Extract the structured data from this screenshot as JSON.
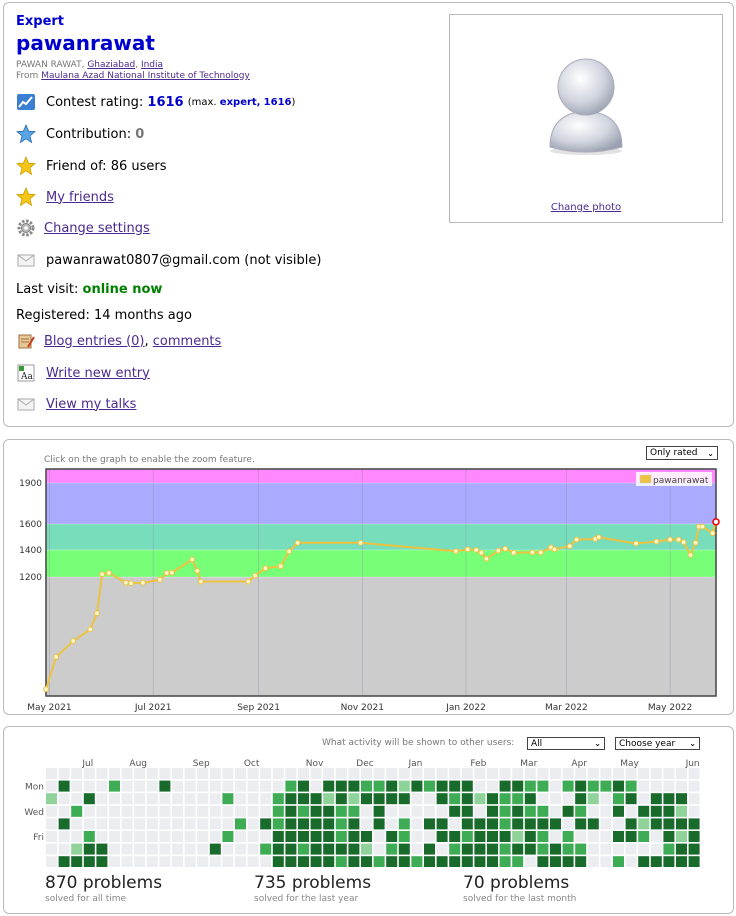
{
  "profile": {
    "rank": "Expert",
    "handle": "pawanrawat",
    "name": "PAWAN RAWAT,",
    "city": "Ghaziabad",
    "country": "India",
    "from_label": "From",
    "org": "Maulana Azad National Institute of Technology",
    "contest_rating_label": "Contest rating:",
    "rating": "1616",
    "max_open": "(max.",
    "max_rank": "expert,",
    "max_rating": "1616",
    "max_close": ")",
    "contribution_label": "Contribution:",
    "contribution": "0",
    "friend_of": "Friend of: 86 users",
    "my_friends": "My friends",
    "change_settings": "Change settings",
    "email": "pawanrawat0807@gmail.com (not visible)",
    "last_visit_label": "Last visit:",
    "last_visit": "online now",
    "registered": "Registered: 14 months ago",
    "blog_entries": "Blog entries (0)",
    "comma": ",",
    "comments": "comments",
    "write_new_entry": "Write new entry",
    "view_my_talks": "View my talks",
    "change_photo": "Change photo",
    "icons": [
      "rating-icon",
      "star-blue-icon",
      "star-icon",
      "star-icon",
      "gear-icon",
      "envelope-icon",
      "blog-icon",
      "write-icon",
      "talks-icon"
    ]
  },
  "rating_graph": {
    "hint": "Click on the graph to enable the zoom feature.",
    "filter_value": "Only rated"
  },
  "chart_data": {
    "type": "line",
    "series": [
      {
        "name": "pawanrawat",
        "color": "#edc240",
        "points": [
          [
            "2021-04-29",
            210
          ],
          [
            "2021-05-05",
            495
          ],
          [
            "2021-05-15",
            635
          ],
          [
            "2021-05-25",
            738
          ],
          [
            "2021-05-29",
            880
          ],
          [
            "2021-06-01",
            1220
          ],
          [
            "2021-06-05",
            1230
          ],
          [
            "2021-06-15",
            1150
          ],
          [
            "2021-06-18",
            1145
          ],
          [
            "2021-06-25",
            1150
          ],
          [
            "2021-07-05",
            1175
          ],
          [
            "2021-07-09",
            1230
          ],
          [
            "2021-07-12",
            1232
          ],
          [
            "2021-07-24",
            1330
          ],
          [
            "2021-07-27",
            1245
          ],
          [
            "2021-07-29",
            1160
          ],
          [
            "2021-08-26",
            1160
          ],
          [
            "2021-08-30",
            1210
          ],
          [
            "2021-09-05",
            1265
          ],
          [
            "2021-09-14",
            1280
          ],
          [
            "2021-09-19",
            1390
          ],
          [
            "2021-09-24",
            1455
          ],
          [
            "2021-10-31",
            1455
          ],
          [
            "2021-12-26",
            1390
          ],
          [
            "2022-01-02",
            1405
          ],
          [
            "2022-01-07",
            1400
          ],
          [
            "2022-01-10",
            1380
          ],
          [
            "2022-01-13",
            1335
          ],
          [
            "2022-01-20",
            1395
          ],
          [
            "2022-01-24",
            1410
          ],
          [
            "2022-01-29",
            1380
          ],
          [
            "2022-02-09",
            1382
          ],
          [
            "2022-02-14",
            1382
          ],
          [
            "2022-02-20",
            1420
          ],
          [
            "2022-02-22",
            1405
          ],
          [
            "2022-03-03",
            1430
          ],
          [
            "2022-03-07",
            1480
          ],
          [
            "2022-03-18",
            1485
          ],
          [
            "2022-03-20",
            1498
          ],
          [
            "2022-04-11",
            1450
          ],
          [
            "2022-04-23",
            1465
          ],
          [
            "2022-05-01",
            1480
          ],
          [
            "2022-05-06",
            1480
          ],
          [
            "2022-05-09",
            1460
          ],
          [
            "2022-05-13",
            1363
          ],
          [
            "2022-05-16",
            1455
          ],
          [
            "2022-05-18",
            1580
          ],
          [
            "2022-05-20",
            1580
          ],
          [
            "2022-05-26",
            1530
          ],
          [
            "2022-05-28",
            1616
          ]
        ]
      }
    ],
    "x_range": [
      "2021-04-29",
      "2022-05-28"
    ],
    "y_range": [
      150,
      2000
    ],
    "y_scale": "piecewise",
    "y_ticks": [
      1200,
      1400,
      1600,
      1900
    ],
    "x_ticks": [
      {
        "date": "2021-05-01",
        "label": "May 2021"
      },
      {
        "date": "2021-07-01",
        "label": "Jul 2021"
      },
      {
        "date": "2021-09-01",
        "label": "Sep 2021"
      },
      {
        "date": "2021-11-01",
        "label": "Nov 2021"
      },
      {
        "date": "2022-01-01",
        "label": "Jan 2022"
      },
      {
        "date": "2022-03-01",
        "label": "Mar 2022"
      },
      {
        "date": "2022-05-01",
        "label": "May 2022"
      }
    ],
    "bands": [
      {
        "from": 0,
        "to": 1200,
        "color": "#cccccc"
      },
      {
        "from": 1200,
        "to": 1400,
        "color": "#77ff77"
      },
      {
        "from": 1400,
        "to": 1600,
        "color": "#77ddbb"
      },
      {
        "from": 1600,
        "to": 1900,
        "color": "#aaaaff"
      },
      {
        "from": 1900,
        "to": 2000,
        "color": "#ff88ff"
      }
    ],
    "legend": "top-right",
    "grid": true
  },
  "activity": {
    "visibility_label": "What activity will be shown to other users:",
    "visibility_value": "All",
    "year_value": "Choose year",
    "months": [
      "Jul",
      "Aug",
      "Sep",
      "Oct",
      "Nov",
      "Dec",
      "Jan",
      "Feb",
      "Mar",
      "Apr",
      "May",
      "Jun"
    ],
    "days": [
      "Mon",
      "Wed",
      "Fri"
    ],
    "stats": [
      {
        "value": "870 problems",
        "label": "solved for all time"
      },
      {
        "value": "735 problems",
        "label": "solved for the last year"
      },
      {
        "value": "70 problems",
        "label": "solved for the last month"
      }
    ],
    "level_colors": [
      "#ebedf0",
      "#8fd39a",
      "#3dac55",
      "#196b2b"
    ],
    "grid_levels": [
      "0000000000000000000000000000000000000000000000000000",
      "0300020003000000000230333223132333003322023223200000",
      "1003000000000020002333131333300323132230003102303330",
      "0020000000000000002323322030000033032322032003033310",
      "0300000000000002032333323030203303332333303300313333",
      "0002000000000020003333323303200332333132020003320313",
      "0013300000000300023323333102303023332332322000000233",
      "0333300000000000003333323323323333332203333002033333"
    ]
  }
}
